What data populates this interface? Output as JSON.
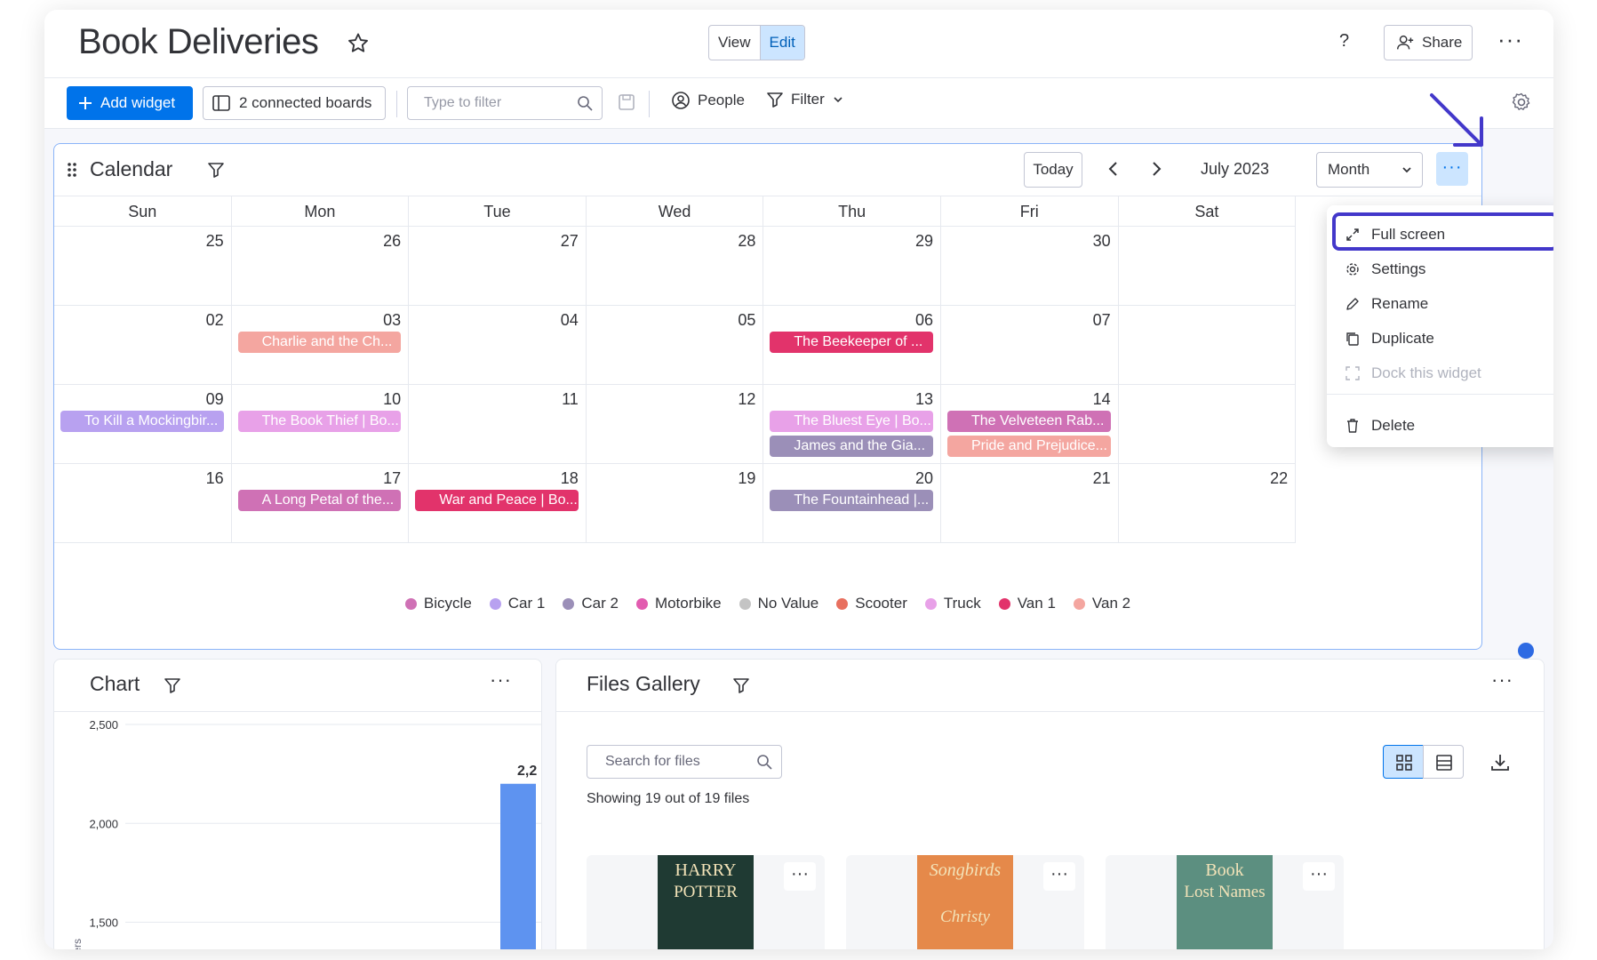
{
  "header": {
    "board_title": "Book Deliveries",
    "view_label": "View",
    "edit_label": "Edit",
    "help_label": "?",
    "share_label": "Share",
    "more_label": "···"
  },
  "toolbar": {
    "add_widget_label": "Add widget",
    "connected_boards_label": "2 connected boards",
    "filter_placeholder": "Type to filter",
    "people_label": "People",
    "filter_label": "Filter"
  },
  "calendar": {
    "title": "Calendar",
    "today_label": "Today",
    "month_label": "July 2023",
    "view_select": "Month",
    "more_label": "···",
    "days_of_week": [
      "Sun",
      "Mon",
      "Tue",
      "Wed",
      "Thu",
      "Fri",
      "Sat"
    ],
    "weeks": [
      [
        "25",
        "26",
        "27",
        "28",
        "29",
        "30",
        ""
      ],
      [
        "02",
        "03",
        "04",
        "05",
        "06",
        "07",
        ""
      ],
      [
        "09",
        "10",
        "11",
        "12",
        "13",
        "14",
        ""
      ],
      [
        "16",
        "17",
        "18",
        "19",
        "20",
        "21",
        "22"
      ]
    ],
    "events": [
      {
        "week": 1,
        "day": 1,
        "slot": 0,
        "label": "Charlie and the Ch...",
        "color": "#f4a6a0"
      },
      {
        "week": 1,
        "day": 4,
        "slot": 0,
        "label": "The Beekeeper of ...",
        "color": "#e2336b"
      },
      {
        "week": 2,
        "day": 0,
        "slot": 0,
        "label": "To Kill a Mockingbir...",
        "color": "#b8a1f0"
      },
      {
        "week": 2,
        "day": 1,
        "slot": 0,
        "label": "The Book Thief | Bo...",
        "color": "#e8a1e8"
      },
      {
        "week": 2,
        "day": 4,
        "slot": 0,
        "label": "The Bluest Eye | Bo...",
        "color": "#e8a1e8"
      },
      {
        "week": 2,
        "day": 4,
        "slot": 1,
        "label": "James and the Gia...",
        "color": "#9b8fb8"
      },
      {
        "week": 2,
        "day": 5,
        "slot": 0,
        "label": "The Velveteen Rab...",
        "color": "#cf71b5"
      },
      {
        "week": 2,
        "day": 5,
        "slot": 1,
        "label": "Pride and Prejudice...",
        "color": "#f4a6a0"
      },
      {
        "week": 3,
        "day": 1,
        "slot": 0,
        "label": "A Long Petal of the...",
        "color": "#cf71b5"
      },
      {
        "week": 3,
        "day": 2,
        "slot": 0,
        "label": "War and Peace | Bo...",
        "color": "#e2336b"
      },
      {
        "week": 3,
        "day": 4,
        "slot": 0,
        "label": "The Fountainhead |...",
        "color": "#9b8fb8"
      }
    ],
    "legend": [
      {
        "label": "Bicycle",
        "color": "#cf71b5"
      },
      {
        "label": "Car 1",
        "color": "#b8a1f0"
      },
      {
        "label": "Car 2",
        "color": "#9b8fb8"
      },
      {
        "label": "Motorbike",
        "color": "#e25cb0"
      },
      {
        "label": "No Value",
        "color": "#c4c4c4"
      },
      {
        "label": "Scooter",
        "color": "#e8705f"
      },
      {
        "label": "Truck",
        "color": "#e8a1e8"
      },
      {
        "label": "Van 1",
        "color": "#e2336b"
      },
      {
        "label": "Van 2",
        "color": "#f4a6a0"
      }
    ]
  },
  "widget_menu": {
    "items": [
      {
        "label": "Full screen",
        "icon": "expand-icon",
        "disabled": false
      },
      {
        "label": "Settings",
        "icon": "gear-icon",
        "disabled": false
      },
      {
        "label": "Rename",
        "icon": "pencil-icon",
        "disabled": false
      },
      {
        "label": "Duplicate",
        "icon": "duplicate-icon",
        "disabled": false
      },
      {
        "label": "Dock this widget",
        "icon": "dock-icon",
        "disabled": true
      },
      {
        "label": "Delete",
        "icon": "trash-icon",
        "disabled": false
      }
    ]
  },
  "chart": {
    "title": "Chart",
    "more_label": "···",
    "ylabel_fragment": "ters",
    "bar_label_fragment": "2,2"
  },
  "chart_data": {
    "type": "bar",
    "yticks": [
      "2,500",
      "2,000",
      "1,500"
    ],
    "ylim": [
      1300,
      2500
    ],
    "values": [
      2200
    ]
  },
  "gallery": {
    "title": "Files Gallery",
    "more_label": "···",
    "search_placeholder": "Search for files",
    "showing_text": "Showing 19 out of 19 files",
    "files": [
      {
        "line1": "HARRY",
        "line2": "POTTER",
        "bg": "#1f3a33"
      },
      {
        "line1": "Songbirds",
        "line2": "Christy",
        "bg": "#e5894a"
      },
      {
        "line1": "Book",
        "line2": "Lost Names",
        "bg": "#5c8f80"
      }
    ]
  },
  "colors": {
    "accent": "#0073ea",
    "highlight": "#4338ca"
  }
}
